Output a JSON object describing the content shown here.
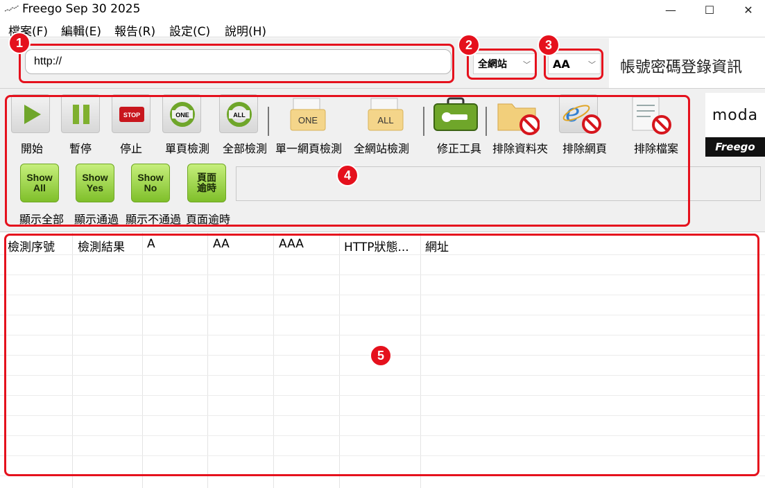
{
  "window": {
    "title": "Freego Sep 30 2025",
    "minimize": "—",
    "maximize": "☐",
    "close": "✕"
  },
  "menu": [
    "檔案(F)",
    "編輯(E)",
    "報告(R)",
    "設定(C)",
    "說明(H)"
  ],
  "url": {
    "value": "http://"
  },
  "scope": {
    "selected": "全網站"
  },
  "level": {
    "selected": "AA"
  },
  "login_info": "帳號密碼登錄資訊",
  "toolbar": {
    "buttons": [
      {
        "label": "開始",
        "icon": "play-icon"
      },
      {
        "label": "暫停",
        "icon": "pause-icon"
      },
      {
        "label": "停止",
        "icon": "stop-icon",
        "text": "STOP"
      },
      {
        "label": "單頁檢測",
        "icon": "refresh-one-icon",
        "text": "ONE"
      },
      {
        "label": "全部檢測",
        "icon": "refresh-all-icon",
        "text": "ALL"
      },
      {
        "label": "單一網頁檢測",
        "icon": "doc-one-icon",
        "text": "ONE"
      },
      {
        "label": "全網站檢測",
        "icon": "doc-all-icon",
        "text": "ALL"
      },
      {
        "label": "修正工具",
        "icon": "toolbox-icon"
      },
      {
        "label": "排除資料夾",
        "icon": "exclude-folder-icon"
      },
      {
        "label": "排除網頁",
        "icon": "exclude-webpage-icon"
      },
      {
        "label": "排除檔案",
        "icon": "exclude-file-icon"
      }
    ],
    "show_buttons": [
      {
        "text": "Show All",
        "label": "顯示全部"
      },
      {
        "text": "Show Yes",
        "label": "顯示通過"
      },
      {
        "text": "Show No",
        "label": "顯示不通過"
      },
      {
        "text": "頁面逾時",
        "label": "頁面逾時"
      }
    ]
  },
  "logo": {
    "moda": "moda",
    "freego": "Freego"
  },
  "table": {
    "columns": [
      "檢測序號",
      "檢測結果",
      "A",
      "AA",
      "AAA",
      "HTTP狀態...",
      "網址"
    ]
  },
  "annotations": [
    "1",
    "2",
    "3",
    "4",
    "5"
  ],
  "colors": {
    "annotation_red": "#e5111d",
    "button_green": "#8cc63f",
    "toolbar_bg": "#f0f0f0"
  }
}
